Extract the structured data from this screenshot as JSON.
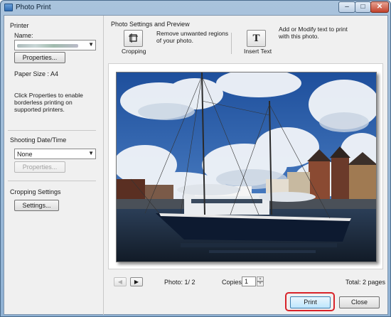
{
  "window": {
    "title": "Photo Print",
    "min_glyph": "–",
    "max_glyph": "□",
    "close_glyph": "✕"
  },
  "printer": {
    "section_label": "Printer",
    "name_label": "Name:",
    "name_value": "",
    "properties_button": "Properties...",
    "paper_size": "Paper Size : A4",
    "note": "Click Properties to enable borderless printing on supported printers."
  },
  "shooting_date": {
    "section_label": "Shooting Date/Time",
    "selected": "None",
    "properties_button": "Properties..."
  },
  "cropping_settings": {
    "section_label": "Cropping Settings",
    "settings_button": "Settings..."
  },
  "photo_settings": {
    "section_label": "Photo Settings and Preview",
    "cropping_caption": "Cropping",
    "cropping_desc": "Remove unwanted regions of your photo.",
    "insert_text_caption": "Insert Text",
    "insert_text_icon": "T",
    "insert_text_desc": "Add or Modify text to print with this photo."
  },
  "footer": {
    "photo_counter": "Photo: 1/ 2",
    "copies_label": "Copies:",
    "copies_value": "1",
    "total_pages": "Total: 2 pages",
    "prev_glyph": "◀",
    "next_glyph": "▶"
  },
  "actions": {
    "print_button": "Print",
    "close_button": "Close"
  },
  "colors": {
    "highlight": "#d8232a",
    "titlebar": "#9fbbd8"
  }
}
